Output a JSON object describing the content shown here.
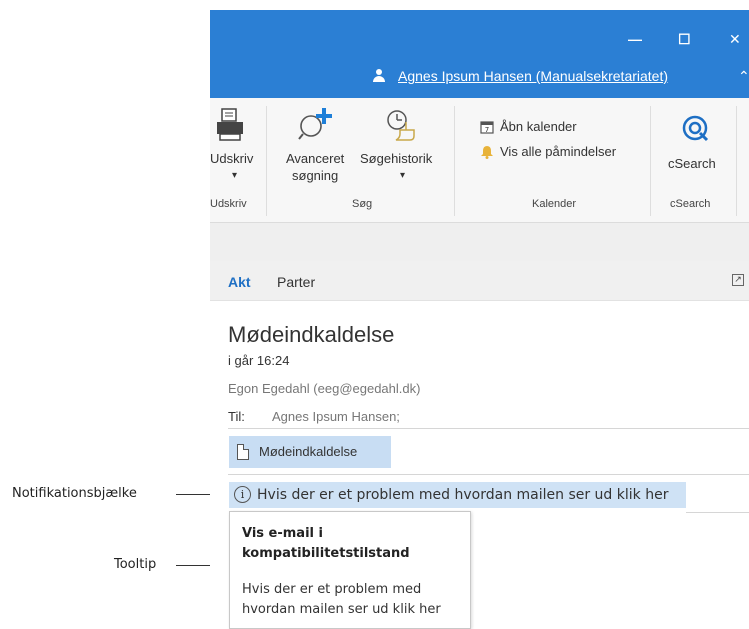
{
  "annotations": {
    "notification_label": "Notifikationsbjælke",
    "tooltip_label": "Tooltip"
  },
  "window": {
    "minimize_glyph": "—",
    "maximize_glyph": "☐",
    "close_glyph": "✕",
    "user": "Agnes Ipsum Hansen (Manualsekretariatet)",
    "collapse_glyph": "⌃"
  },
  "ribbon": {
    "print": {
      "label": "Udskriv",
      "dropdown": "▾",
      "group": "Udskriv"
    },
    "advanced_search": {
      "label_line1": "Avanceret",
      "label_line2": "søgning"
    },
    "search_history": {
      "label": "Søgehistorik",
      "dropdown": "▾"
    },
    "search_group": "Søg",
    "open_calendar": "Åbn kalender",
    "all_reminders": "Vis alle påmindelser",
    "calendar_group": "Kalender",
    "csearch": {
      "label": "cSearch",
      "group": "cSearch"
    }
  },
  "pane": {
    "tabs": [
      {
        "label": "Akt",
        "active": true
      },
      {
        "label": "Parter",
        "active": false
      }
    ]
  },
  "email": {
    "subject": "Mødeindkaldelse",
    "date": "i går 16:24",
    "sender": "Egon Egedahl (eeg@egedahl.dk)",
    "to_label": "Til:",
    "to_value": "Agnes Ipsum Hansen;",
    "attachment": "Mødeindkaldelse"
  },
  "notification": {
    "text": "Hvis der er et problem med hvordan mailen ser ud klik her",
    "icon": "info-icon"
  },
  "tooltip": {
    "title": "Vis e-mail i kompatibilitetstilstand",
    "body": "Hvis der er et problem med hvordan mailen ser ud klik her"
  },
  "colors": {
    "titlebar": "#2b7fd4",
    "accent": "#1e6fc4",
    "highlight": "#cfe2f5"
  }
}
